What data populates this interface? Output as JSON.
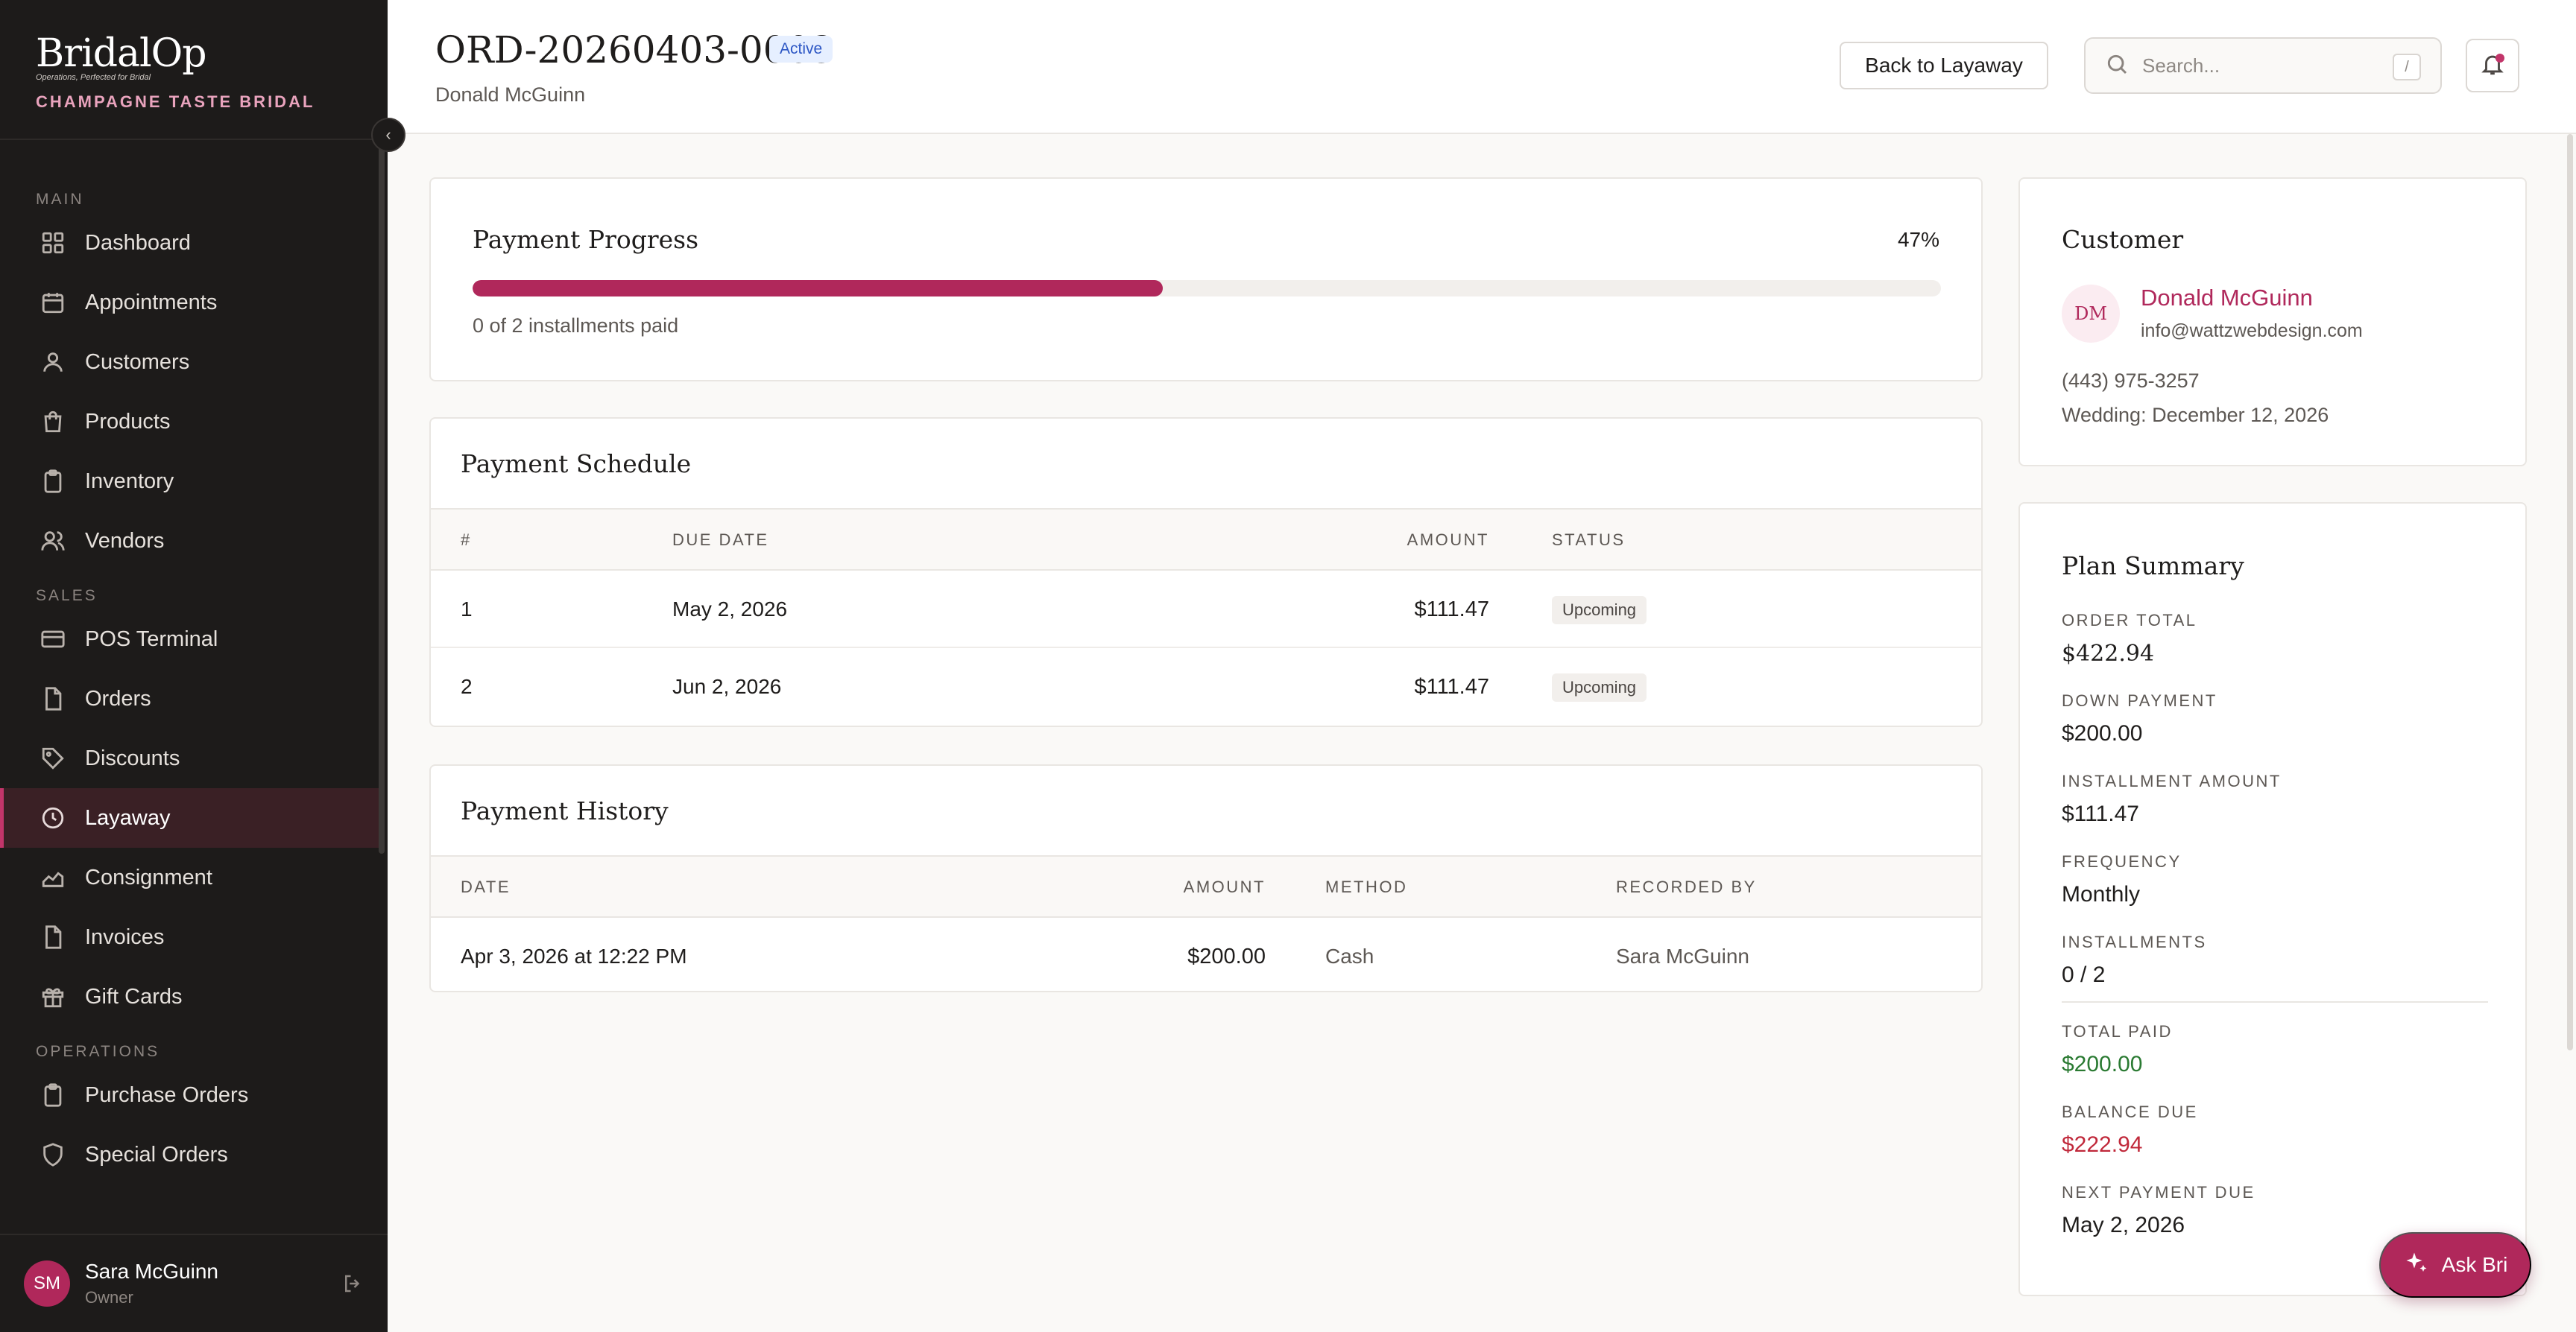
{
  "brand": {
    "logo": "BridalOp",
    "tagline": "Operations, Perfected for Bridal",
    "store": "CHAMPAGNE TASTE BRIDAL"
  },
  "nav": {
    "sections": [
      {
        "label": "MAIN",
        "items": [
          {
            "label": "Dashboard",
            "icon": "grid-icon"
          },
          {
            "label": "Appointments",
            "icon": "calendar-icon"
          },
          {
            "label": "Customers",
            "icon": "user-icon"
          },
          {
            "label": "Products",
            "icon": "bag-icon"
          },
          {
            "label": "Inventory",
            "icon": "clipboard-icon"
          },
          {
            "label": "Vendors",
            "icon": "users-icon"
          }
        ]
      },
      {
        "label": "SALES",
        "items": [
          {
            "label": "POS Terminal",
            "icon": "card-icon"
          },
          {
            "label": "Orders",
            "icon": "file-icon"
          },
          {
            "label": "Discounts",
            "icon": "tag-icon"
          },
          {
            "label": "Layaway",
            "icon": "clock-icon",
            "active": true
          },
          {
            "label": "Consignment",
            "icon": "chart-icon"
          },
          {
            "label": "Invoices",
            "icon": "file-icon"
          },
          {
            "label": "Gift Cards",
            "icon": "gift-icon"
          }
        ]
      },
      {
        "label": "OPERATIONS",
        "items": [
          {
            "label": "Purchase Orders",
            "icon": "clipboard-icon"
          },
          {
            "label": "Special Orders",
            "icon": "shield-icon"
          }
        ]
      }
    ]
  },
  "user": {
    "initials": "SM",
    "name": "Sara McGuinn",
    "role": "Owner"
  },
  "header": {
    "order_id": "ORD-20260403-0003",
    "status": "Active",
    "customer": "Donald McGuinn",
    "back_label": "Back to Layaway",
    "search_placeholder": "Search...",
    "search_shortcut": "/"
  },
  "progress": {
    "title": "Payment Progress",
    "percent_label": "47%",
    "percent": 47,
    "caption": "0 of 2 installments paid"
  },
  "schedule": {
    "title": "Payment Schedule",
    "columns": [
      "#",
      "DUE DATE",
      "AMOUNT",
      "STATUS"
    ],
    "rows": [
      {
        "num": "1",
        "due": "May 2, 2026",
        "amount": "$111.47",
        "status": "Upcoming"
      },
      {
        "num": "2",
        "due": "Jun 2, 2026",
        "amount": "$111.47",
        "status": "Upcoming"
      }
    ]
  },
  "history": {
    "title": "Payment History",
    "columns": [
      "DATE",
      "AMOUNT",
      "METHOD",
      "RECORDED BY"
    ],
    "rows": [
      {
        "date": "Apr 3, 2026 at 12:22 PM",
        "amount": "$200.00",
        "method": "Cash",
        "recorded_by": "Sara McGuinn"
      }
    ]
  },
  "customer": {
    "title": "Customer",
    "initials": "DM",
    "name": "Donald McGuinn",
    "email": "info@wattzwebdesign.com",
    "phone": "(443) 975-3257",
    "wedding": "Wedding: December 12, 2026"
  },
  "plan": {
    "title": "Plan Summary",
    "items": [
      {
        "label": "ORDER TOTAL",
        "value": "$422.94"
      },
      {
        "label": "DOWN PAYMENT",
        "value": "$200.00"
      },
      {
        "label": "INSTALLMENT AMOUNT",
        "value": "$111.47"
      },
      {
        "label": "FREQUENCY",
        "value": "Monthly"
      },
      {
        "label": "INSTALLMENTS",
        "value": "0 / 2"
      },
      {
        "label": "TOTAL PAID",
        "value": "$200.00"
      },
      {
        "label": "BALANCE DUE",
        "value": "$222.94"
      },
      {
        "label": "NEXT PAYMENT DUE",
        "value": "May 2, 2026"
      }
    ]
  },
  "assistant": {
    "label": "Ask Bri"
  },
  "colors": {
    "accent": "#b0285b",
    "sidebar": "#1d1b1a",
    "paid": "#2a7a32",
    "due": "#c0283a",
    "status_badge": "#2c56c4"
  }
}
